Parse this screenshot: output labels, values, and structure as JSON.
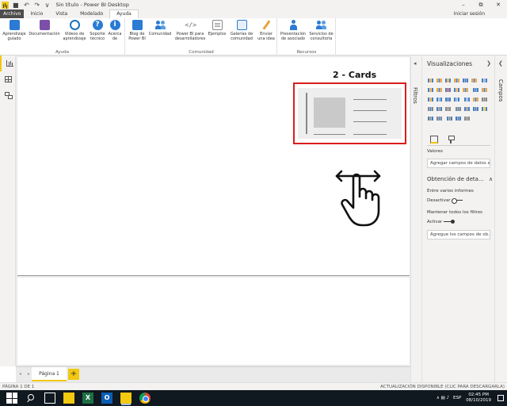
{
  "window": {
    "title": "Sin título - Power BI Desktop",
    "quick_access": "■ ↶ ↷ ∨",
    "buttons": [
      "–",
      "⧉",
      "✕"
    ]
  },
  "tabs": [
    {
      "label": "Archivo"
    },
    {
      "label": "Inicio"
    },
    {
      "label": "Vista"
    },
    {
      "label": "Modelado"
    },
    {
      "label": "Ayuda"
    }
  ],
  "signin": "Iniciar sesión",
  "ribbon": {
    "groups": [
      {
        "name": "Ayuda"
      },
      {
        "name": "Comunidad"
      },
      {
        "name": "Recursos"
      }
    ],
    "buttons": [
      {
        "label1": "Aprendizaje",
        "label2": "guiado",
        "icon": "graduation-icon"
      },
      {
        "label1": "Documentación",
        "label2": "",
        "icon": "book-icon"
      },
      {
        "label1": "Vídeos de",
        "label2": "aprendizaje",
        "icon": "globe-icon"
      },
      {
        "label1": "Soporte",
        "label2": "técnico",
        "icon": "help-icon",
        "glyph": "?"
      },
      {
        "label1": "Acerca",
        "label2": "de",
        "icon": "info-icon",
        "glyph": "i"
      },
      {
        "label1": "Blog de",
        "label2": "Power BI",
        "icon": "blog-icon"
      },
      {
        "label1": "Comunidad",
        "label2": "",
        "icon": "community-icon"
      },
      {
        "label1": "Power BI para",
        "label2": "desarrolladores",
        "icon": "code-icon",
        "glyph": "</>"
      },
      {
        "label1": "Ejemplos",
        "label2": "",
        "icon": "samples-icon"
      },
      {
        "label1": "Galerías de",
        "label2": "comunidad",
        "icon": "gallery-icon"
      },
      {
        "label1": "Enviar",
        "label2": "una idea",
        "icon": "idea-icon"
      },
      {
        "label1": "Presentación",
        "label2": "de asociado",
        "icon": "partner-icon"
      },
      {
        "label1": "Servicios de",
        "label2": "consultoría",
        "icon": "consulting-icon"
      }
    ]
  },
  "canvas": {
    "label": "2 - Cards"
  },
  "pages": {
    "tab": "Página 1",
    "add": "+",
    "nav": "◂ ▸"
  },
  "status": {
    "page": "PÁGINA 1 DE 1",
    "update": "ACTUALIZACIÓN DISPONIBLE (CLIC PARA DESCARGARLA)"
  },
  "filters": {
    "label": "Filtros",
    "arrow": "◂"
  },
  "viz": {
    "title": "Visualizaciones",
    "close": "❯",
    "values_label": "Valores",
    "values_placeholder": "Agregar campos de datos a...",
    "drillthrough_title": "Obtención de deta...",
    "cross_report_label": "Entre varios informes",
    "cross_report_toggle": "Desactivar",
    "keep_filters_label": "Mantener todos los filtros",
    "keep_filters_toggle": "Activar",
    "drillthrough_placeholder": "Agregue los campos de ob...",
    "chevron": "∧"
  },
  "campos": {
    "label": "Campos",
    "arrow": "❮"
  },
  "taskbar": {
    "lang": "ESP",
    "time": "02:45 PM",
    "date": "08/10/2019",
    "tray_icons": "∧ ▤ ♪"
  },
  "colors": {
    "accent": "#f2c811",
    "highlight": "#d91c1c"
  }
}
